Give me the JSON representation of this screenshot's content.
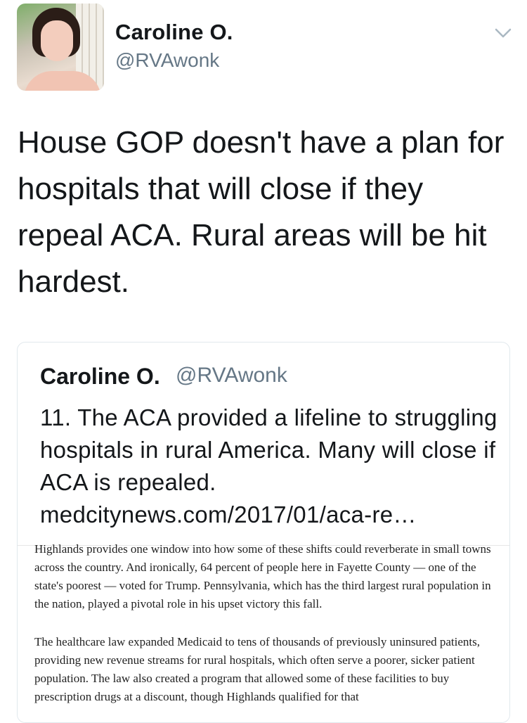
{
  "tweet": {
    "name": "Caroline O.",
    "handle": "@RVAwonk",
    "text": "House GOP doesn't have a plan for hospitals that will close if they repeal ACA. Rural areas will be hit hardest."
  },
  "quoted_tweet": {
    "name": "Caroline O.",
    "handle": "@RVAwonk",
    "text": "11. The ACA provided a lifeline to struggling hospitals in rural America. Many will close if ACA is repealed. medcitynews.com/2017/01/aca-re…"
  },
  "article": {
    "paragraph1": "Highlands provides one window into how some of these shifts could reverberate in small towns across the country. And ironically, 64 percent of people here in Fayette County — one of the state's poorest — voted for Trump. Pennsylvania, which has the third largest rural population in the nation, played a pivotal role in his upset victory this fall.",
    "paragraph2": "The healthcare law expanded Medicaid to tens of thousands of previously uninsured patients, providing new revenue streams for rural hospitals, which often serve a poorer, sicker patient population. The law also created a program that allowed some of these facilities to buy prescription drugs at a discount, though Highlands qualified for that"
  },
  "icons": {
    "menu": "chevron-down-icon"
  },
  "colors": {
    "text": "#14171a",
    "secondary": "#657786",
    "border": "#e1e8ed"
  }
}
